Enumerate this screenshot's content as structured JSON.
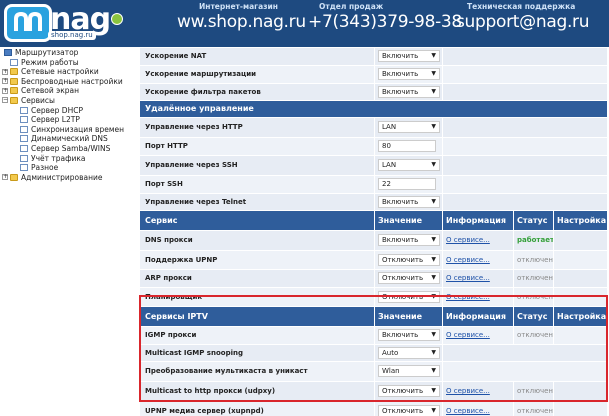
{
  "header": {
    "logo_text": "nag",
    "logo_sub": "shop.nag.ru",
    "shop_caption": "Интернет-магазин",
    "shop_url": "ww.shop.nag.ru",
    "sales_caption": "Отдел продаж",
    "sales_phone": "+7(343)379-98-38",
    "support_caption": "Техническая поддержка",
    "support_email": "support@nag.ru",
    "colors": {
      "bar": "#1e4a80",
      "logo": "#2aa2df",
      "dot": "#8ac43f"
    }
  },
  "sidebar": {
    "items": [
      {
        "label": "Маршрутизатор",
        "icon": "router-icon"
      },
      {
        "label": "Режим работы",
        "icon": "page-icon"
      },
      {
        "label": "Сетевые настройки",
        "icon": "folder-icon"
      },
      {
        "label": "Беспроводные настройки",
        "icon": "folder-icon"
      },
      {
        "label": "Сетевой экран",
        "icon": "folder-icon"
      },
      {
        "label": "Сервисы",
        "icon": "folder-open-icon"
      },
      {
        "label": "Сервер DHCP",
        "icon": "page-icon"
      },
      {
        "label": "Сервер L2TP",
        "icon": "page-icon"
      },
      {
        "label": "Синхронизация времен",
        "icon": "page-icon"
      },
      {
        "label": "Динамический DNS",
        "icon": "page-icon"
      },
      {
        "label": "Сервер Samba/WINS",
        "icon": "page-icon"
      },
      {
        "label": "Учёт трафика",
        "icon": "page-icon"
      },
      {
        "label": "Разное",
        "icon": "page-icon"
      },
      {
        "label": "Администрирование",
        "icon": "folder-icon"
      }
    ]
  },
  "table": {
    "rows": [
      {
        "kind": "row",
        "label": "Ускорение NAT",
        "value": "Включить",
        "control": "select"
      },
      {
        "kind": "row",
        "label": "Ускорение маршрутизации",
        "value": "Включить",
        "control": "select"
      },
      {
        "kind": "row",
        "label": "Ускорение фильтра пакетов",
        "value": "Включить",
        "control": "select"
      },
      {
        "kind": "section",
        "label": "Удалённое управление"
      },
      {
        "kind": "row",
        "label": "Управление через HTTP",
        "value": "LAN",
        "control": "select"
      },
      {
        "kind": "row",
        "label": "Порт HTTP",
        "value": "80",
        "control": "input"
      },
      {
        "kind": "row",
        "label": "Управление через SSH",
        "value": "LAN",
        "control": "select"
      },
      {
        "kind": "row",
        "label": "Порт SSH",
        "value": "22",
        "control": "input"
      },
      {
        "kind": "row",
        "label": "Управление через Telnet",
        "value": "Включить",
        "control": "select"
      },
      {
        "kind": "header",
        "label": "Сервис",
        "value": "Значение",
        "info": "Информация",
        "status": "Статус",
        "settings": "Настройка"
      },
      {
        "kind": "svc",
        "label": "DNS прокси",
        "value": "Включить",
        "info": "О сервисе...",
        "status": "работает",
        "status_type": "on"
      },
      {
        "kind": "svc",
        "label": "Поддержка UPNP",
        "value": "Отключить",
        "info": "О сервисе...",
        "status": "отключено",
        "status_type": "off"
      },
      {
        "kind": "svc",
        "label": "ARP прокси",
        "value": "Отключить",
        "info": "О сервисе...",
        "status": "отключено",
        "status_type": "off"
      },
      {
        "kind": "svc",
        "label": "Планировщик",
        "value": "Отключить",
        "info": "О сервисе...",
        "status": "отключено",
        "status_type": "off"
      },
      {
        "kind": "header",
        "label": "Сервисы IPTV",
        "value": "Значение",
        "info": "Информация",
        "status": "Статус",
        "settings": "Настройка"
      },
      {
        "kind": "svc",
        "label": "IGMP прокси",
        "value": "Включить",
        "info": "О сервисе...",
        "status": "отключено",
        "status_type": "off"
      },
      {
        "kind": "row",
        "label": "Multicast IGMP snooping",
        "value": "Auto",
        "control": "select"
      },
      {
        "kind": "row",
        "label": "Преобразование мультикаста в уникаст",
        "value": "Wlan",
        "control": "select"
      },
      {
        "kind": "svc",
        "label": "Multicast to http прокси (udpxy)",
        "value": "Отключить",
        "info": "О сервисе...",
        "status": "отключено",
        "status_type": "off"
      },
      {
        "kind": "svc",
        "label": "UPNP медиа сервер (xupnpd)",
        "value": "Отключить",
        "info": "О сервисе...",
        "status": "отключено",
        "status_type": "off"
      }
    ],
    "colors": {
      "header": "#2f5d9b",
      "row": "#e7ecf4",
      "status_on": "#35a03a",
      "highlight": "#d9262c"
    }
  }
}
